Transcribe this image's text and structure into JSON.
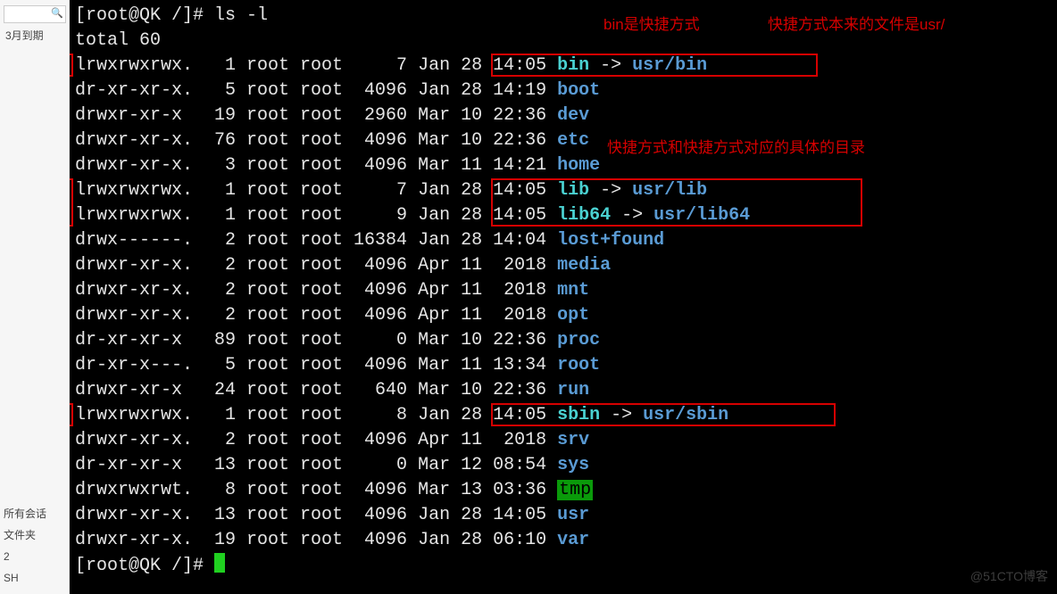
{
  "sidebar": {
    "search_placeholder": "",
    "top_item": "3月到期",
    "bottom": [
      "所有会话",
      "文件夹",
      "2",
      "SH"
    ]
  },
  "terminal": {
    "prompt1": "[root@QK /]# ls -l",
    "total_line": "total 60",
    "prompt2": "[root@QK /]# ",
    "rows": [
      {
        "perm": "lrwxrwxrwx.",
        "links": "1",
        "owner": "root",
        "group": "root",
        "size": "7",
        "date": "Jan 28 14:05",
        "name": "bin",
        "link": "usr/bin",
        "type": "sym"
      },
      {
        "perm": "dr-xr-xr-x.",
        "links": "5",
        "owner": "root",
        "group": "root",
        "size": "4096",
        "date": "Jan 28 14:19",
        "name": "boot",
        "type": "dir"
      },
      {
        "perm": "drwxr-xr-x",
        "links": "19",
        "owner": "root",
        "group": "root",
        "size": "2960",
        "date": "Mar 10 22:36",
        "name": "dev",
        "type": "dir"
      },
      {
        "perm": "drwxr-xr-x.",
        "links": "76",
        "owner": "root",
        "group": "root",
        "size": "4096",
        "date": "Mar 10 22:36",
        "name": "etc",
        "type": "dir"
      },
      {
        "perm": "drwxr-xr-x.",
        "links": "3",
        "owner": "root",
        "group": "root",
        "size": "4096",
        "date": "Mar 11 14:21",
        "name": "home",
        "type": "dir"
      },
      {
        "perm": "lrwxrwxrwx.",
        "links": "1",
        "owner": "root",
        "group": "root",
        "size": "7",
        "date": "Jan 28 14:05",
        "name": "lib",
        "link": "usr/lib",
        "type": "sym"
      },
      {
        "perm": "lrwxrwxrwx.",
        "links": "1",
        "owner": "root",
        "group": "root",
        "size": "9",
        "date": "Jan 28 14:05",
        "name": "lib64",
        "link": "usr/lib64",
        "type": "sym"
      },
      {
        "perm": "drwx------.",
        "links": "2",
        "owner": "root",
        "group": "root",
        "size": "16384",
        "date": "Jan 28 14:04",
        "name": "lost+found",
        "type": "dir"
      },
      {
        "perm": "drwxr-xr-x.",
        "links": "2",
        "owner": "root",
        "group": "root",
        "size": "4096",
        "date": "Apr 11  2018",
        "name": "media",
        "type": "dir"
      },
      {
        "perm": "drwxr-xr-x.",
        "links": "2",
        "owner": "root",
        "group": "root",
        "size": "4096",
        "date": "Apr 11  2018",
        "name": "mnt",
        "type": "dir"
      },
      {
        "perm": "drwxr-xr-x.",
        "links": "2",
        "owner": "root",
        "group": "root",
        "size": "4096",
        "date": "Apr 11  2018",
        "name": "opt",
        "type": "dir"
      },
      {
        "perm": "dr-xr-xr-x",
        "links": "89",
        "owner": "root",
        "group": "root",
        "size": "0",
        "date": "Mar 10 22:36",
        "name": "proc",
        "type": "dir"
      },
      {
        "perm": "dr-xr-x---.",
        "links": "5",
        "owner": "root",
        "group": "root",
        "size": "4096",
        "date": "Mar 11 13:34",
        "name": "root",
        "type": "dir"
      },
      {
        "perm": "drwxr-xr-x",
        "links": "24",
        "owner": "root",
        "group": "root",
        "size": "640",
        "date": "Mar 10 22:36",
        "name": "run",
        "type": "dir"
      },
      {
        "perm": "lrwxrwxrwx.",
        "links": "1",
        "owner": "root",
        "group": "root",
        "size": "8",
        "date": "Jan 28 14:05",
        "name": "sbin",
        "link": "usr/sbin",
        "type": "sym"
      },
      {
        "perm": "drwxr-xr-x.",
        "links": "2",
        "owner": "root",
        "group": "root",
        "size": "4096",
        "date": "Apr 11  2018",
        "name": "srv",
        "type": "dir"
      },
      {
        "perm": "dr-xr-xr-x",
        "links": "13",
        "owner": "root",
        "group": "root",
        "size": "0",
        "date": "Mar 12 08:54",
        "name": "sys",
        "type": "dir"
      },
      {
        "perm": "drwxrwxrwt.",
        "links": "8",
        "owner": "root",
        "group": "root",
        "size": "4096",
        "date": "Mar 13 03:36",
        "name": "tmp",
        "type": "tmp"
      },
      {
        "perm": "drwxr-xr-x.",
        "links": "13",
        "owner": "root",
        "group": "root",
        "size": "4096",
        "date": "Jan 28 14:05",
        "name": "usr",
        "type": "dir"
      },
      {
        "perm": "drwxr-xr-x.",
        "links": "19",
        "owner": "root",
        "group": "root",
        "size": "4096",
        "date": "Jan 28 06:10",
        "name": "var",
        "type": "dir"
      }
    ]
  },
  "annotations": {
    "a1": "bin是快捷方式",
    "a2": "快捷方式本来的文件是usr/",
    "a3": "快捷方式和快捷方式对应的具体的目录"
  },
  "watermark": "@51CTO博客"
}
